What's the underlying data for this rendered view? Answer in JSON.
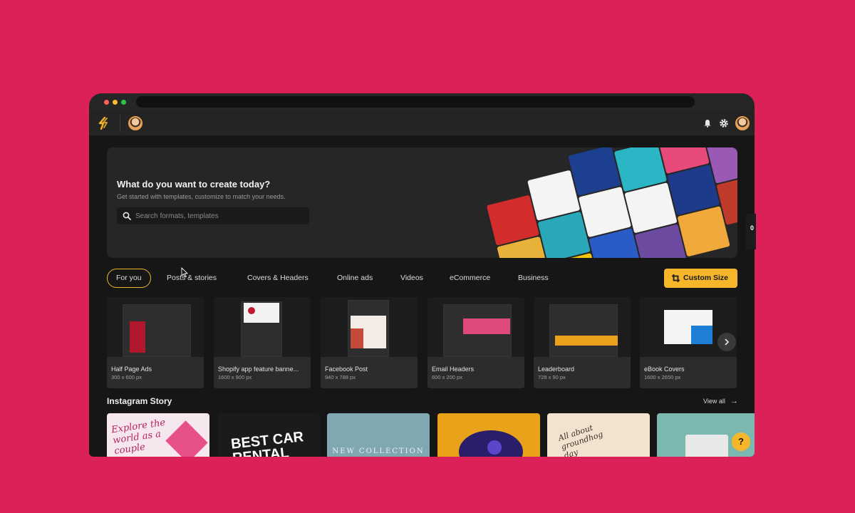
{
  "app": {
    "logo": "brand-logo-icon",
    "accent": "#f5b62a",
    "background": "#dc2158"
  },
  "hero": {
    "title": "What do you want to create today?",
    "subtitle": "Get started with templates, customize to match your needs.",
    "search_placeholder": "Search formats, templates"
  },
  "tabs": [
    {
      "label": "For you",
      "active": true
    },
    {
      "label": "Posts & stories"
    },
    {
      "label": "Covers & Headers"
    },
    {
      "label": "Online ads"
    },
    {
      "label": "Videos"
    },
    {
      "label": "eCommerce"
    },
    {
      "label": "Business"
    }
  ],
  "custom_size": {
    "label": "Custom Size"
  },
  "formats": [
    {
      "name": "Half Page Ads",
      "size": "300 x 600 px"
    },
    {
      "name": "Shopify app feature banne...",
      "size": "1600 x 900 px"
    },
    {
      "name": "Facebook Post",
      "size": "940 x 788 px"
    },
    {
      "name": "Email Headers",
      "size": "600 x 200 px"
    },
    {
      "name": "Leaderboard",
      "size": "728 x 90 px"
    },
    {
      "name": "eBook Covers",
      "size": "1600 x 2650 px"
    }
  ],
  "instagram": {
    "title": "Instagram Story",
    "view_all": "View all",
    "stories": [
      {
        "text": "Explore the world as a couple"
      },
      {
        "text": "BEST CAR RENTAL"
      },
      {
        "text": "NEW COLLECTION"
      },
      {
        "text": ""
      },
      {
        "text": "All about groundhog day"
      },
      {
        "text": ""
      }
    ]
  },
  "help": {
    "label": "?"
  },
  "side_peek": {
    "label": "0"
  }
}
